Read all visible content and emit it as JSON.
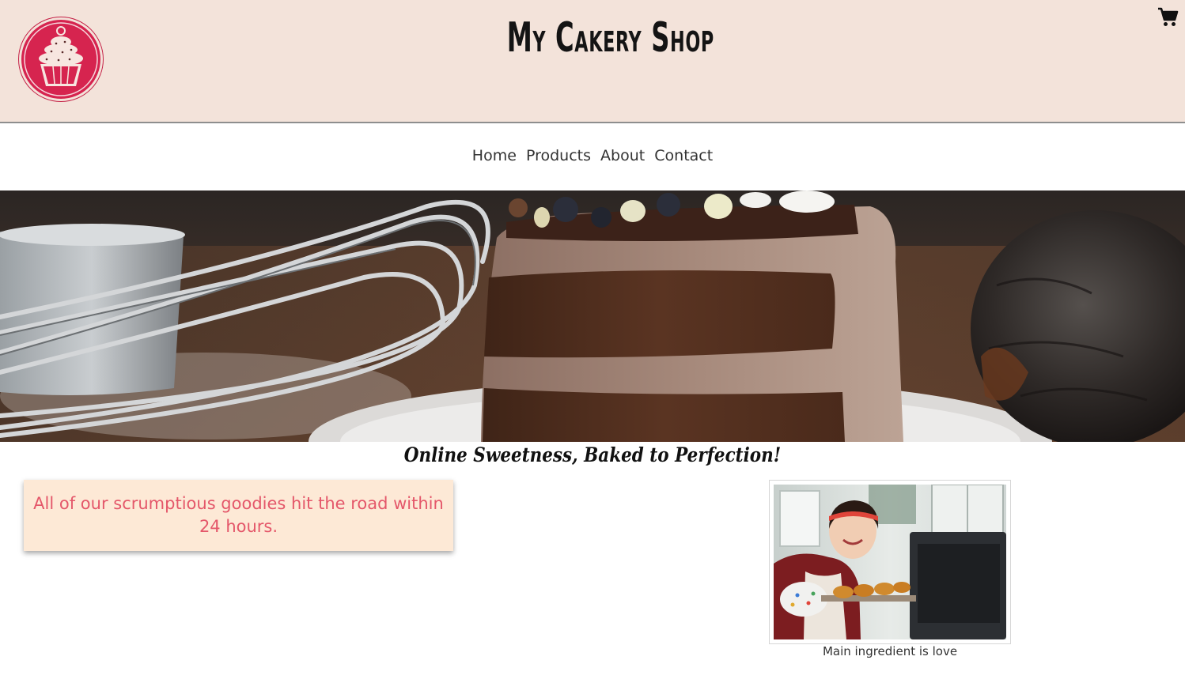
{
  "header": {
    "title": "My Cakery Shop",
    "logo_icon": "cupcake-logo-icon",
    "cart_icon": "shopping-cart-icon"
  },
  "nav": {
    "items": [
      {
        "label": "Home"
      },
      {
        "label": "Products"
      },
      {
        "label": "About"
      },
      {
        "label": "Contact"
      }
    ]
  },
  "hero": {
    "image": "chocolate-cake-slice-with-whisk"
  },
  "main": {
    "tagline": "Online Sweetness, Baked to Perfection!",
    "promo_text": "All of our scrumptious goodies hit the road within 24 hours.",
    "photo_image": "smiling-baker-with-pastry-tray",
    "photo_caption": "Main ingredient is love"
  },
  "colors": {
    "header_bg": "#f3e3da",
    "logo_red": "#d6244f",
    "promo_bg": "#fde9d6",
    "promo_text": "#e4576a"
  }
}
